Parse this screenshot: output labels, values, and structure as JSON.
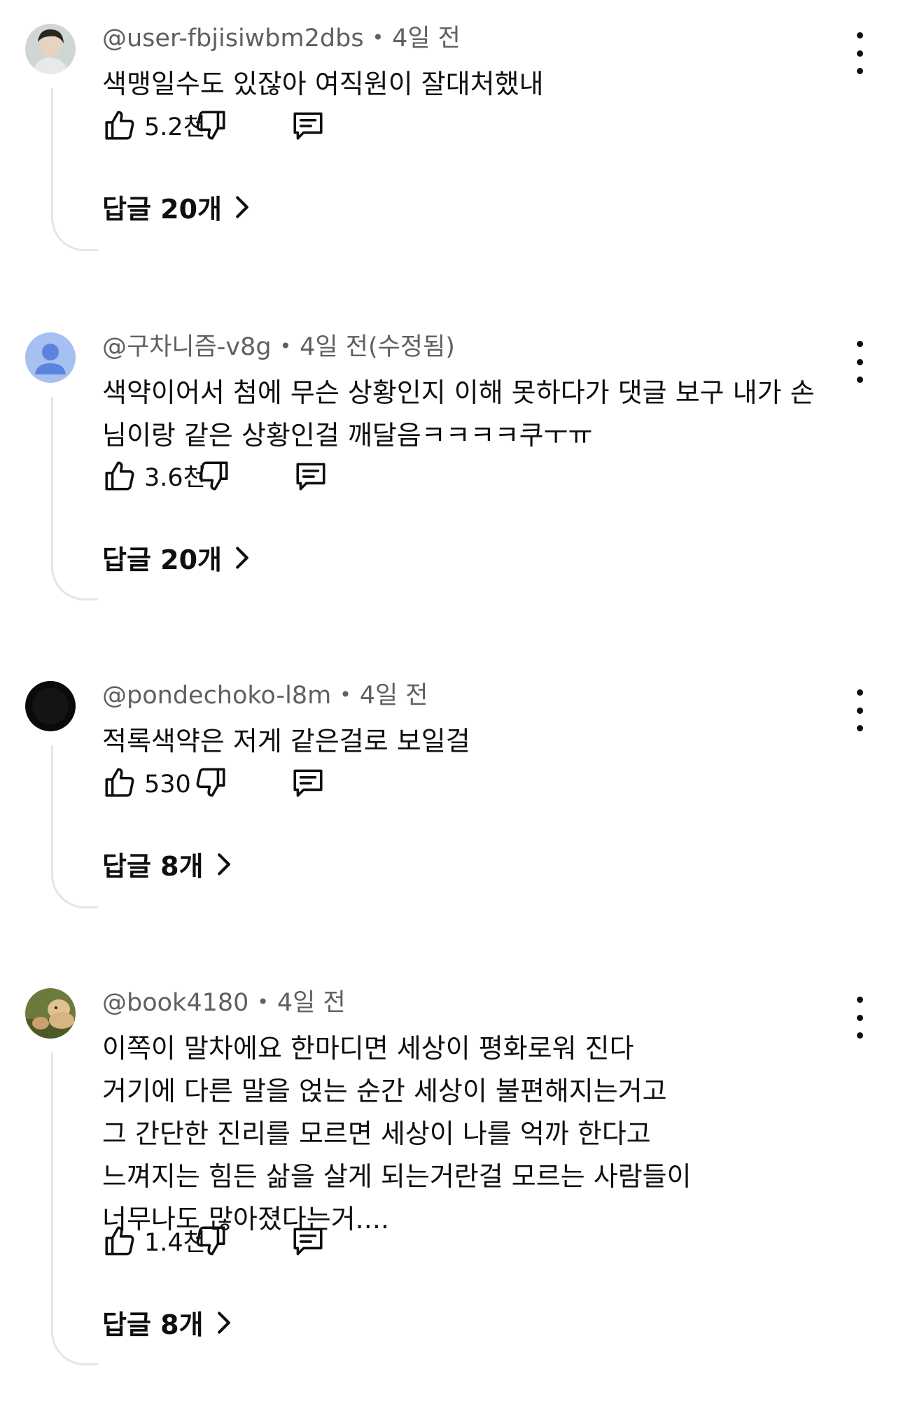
{
  "comments": [
    {
      "author": "@user-fbjisiwbm2dbs",
      "time": "4일 전",
      "lines": [
        "색맹일수도 있잖아 여직원이 잘대처했내"
      ],
      "likes": "5.2천",
      "replies": "답글 20개",
      "avatar": "photo-person"
    },
    {
      "author": "@구차니즘-v8g",
      "time": "4일 전(수정됨)",
      "lines": [
        "색약이어서 첨에 무슨 상황인지 이해 못하다가 댓글 보구 내가 손",
        "님이랑 같은 상황인걸 깨달음ㅋㅋㅋㅋ쿠ㅜㅠ"
      ],
      "likes": "3.6천",
      "replies": "답글 20개",
      "avatar": "default-person"
    },
    {
      "author": "@pondechoko-l8m",
      "time": "4일 전",
      "lines": [
        "적록색약은 저게 같은걸로 보일걸"
      ],
      "likes": "530",
      "replies": "답글 8개",
      "avatar": "photo-dark"
    },
    {
      "author": "@book4180",
      "time": "4일 전",
      "lines": [
        "이쪽이 말차에요 한마디면 세상이 평화로워 진다",
        "거기에 다른 말을 얹는 순간 세상이 불편해지는거고",
        "그 간단한 진리를 모르면 세상이 나를 억까 한다고",
        "느껴지는 힘든 삶을 살게 되는거란걸 모르는 사람들이",
        "너무나도 많아졌다는거...."
      ],
      "likes": "1.4천",
      "replies": "답글 8개",
      "avatar": "photo-dogs"
    }
  ],
  "colors": {
    "text": "#0f0f0f",
    "meta": "#606060",
    "thread": "#e5e5e5",
    "default_avatar_bg": "#a7c0f2",
    "default_avatar_fg": "#5b85dc"
  }
}
